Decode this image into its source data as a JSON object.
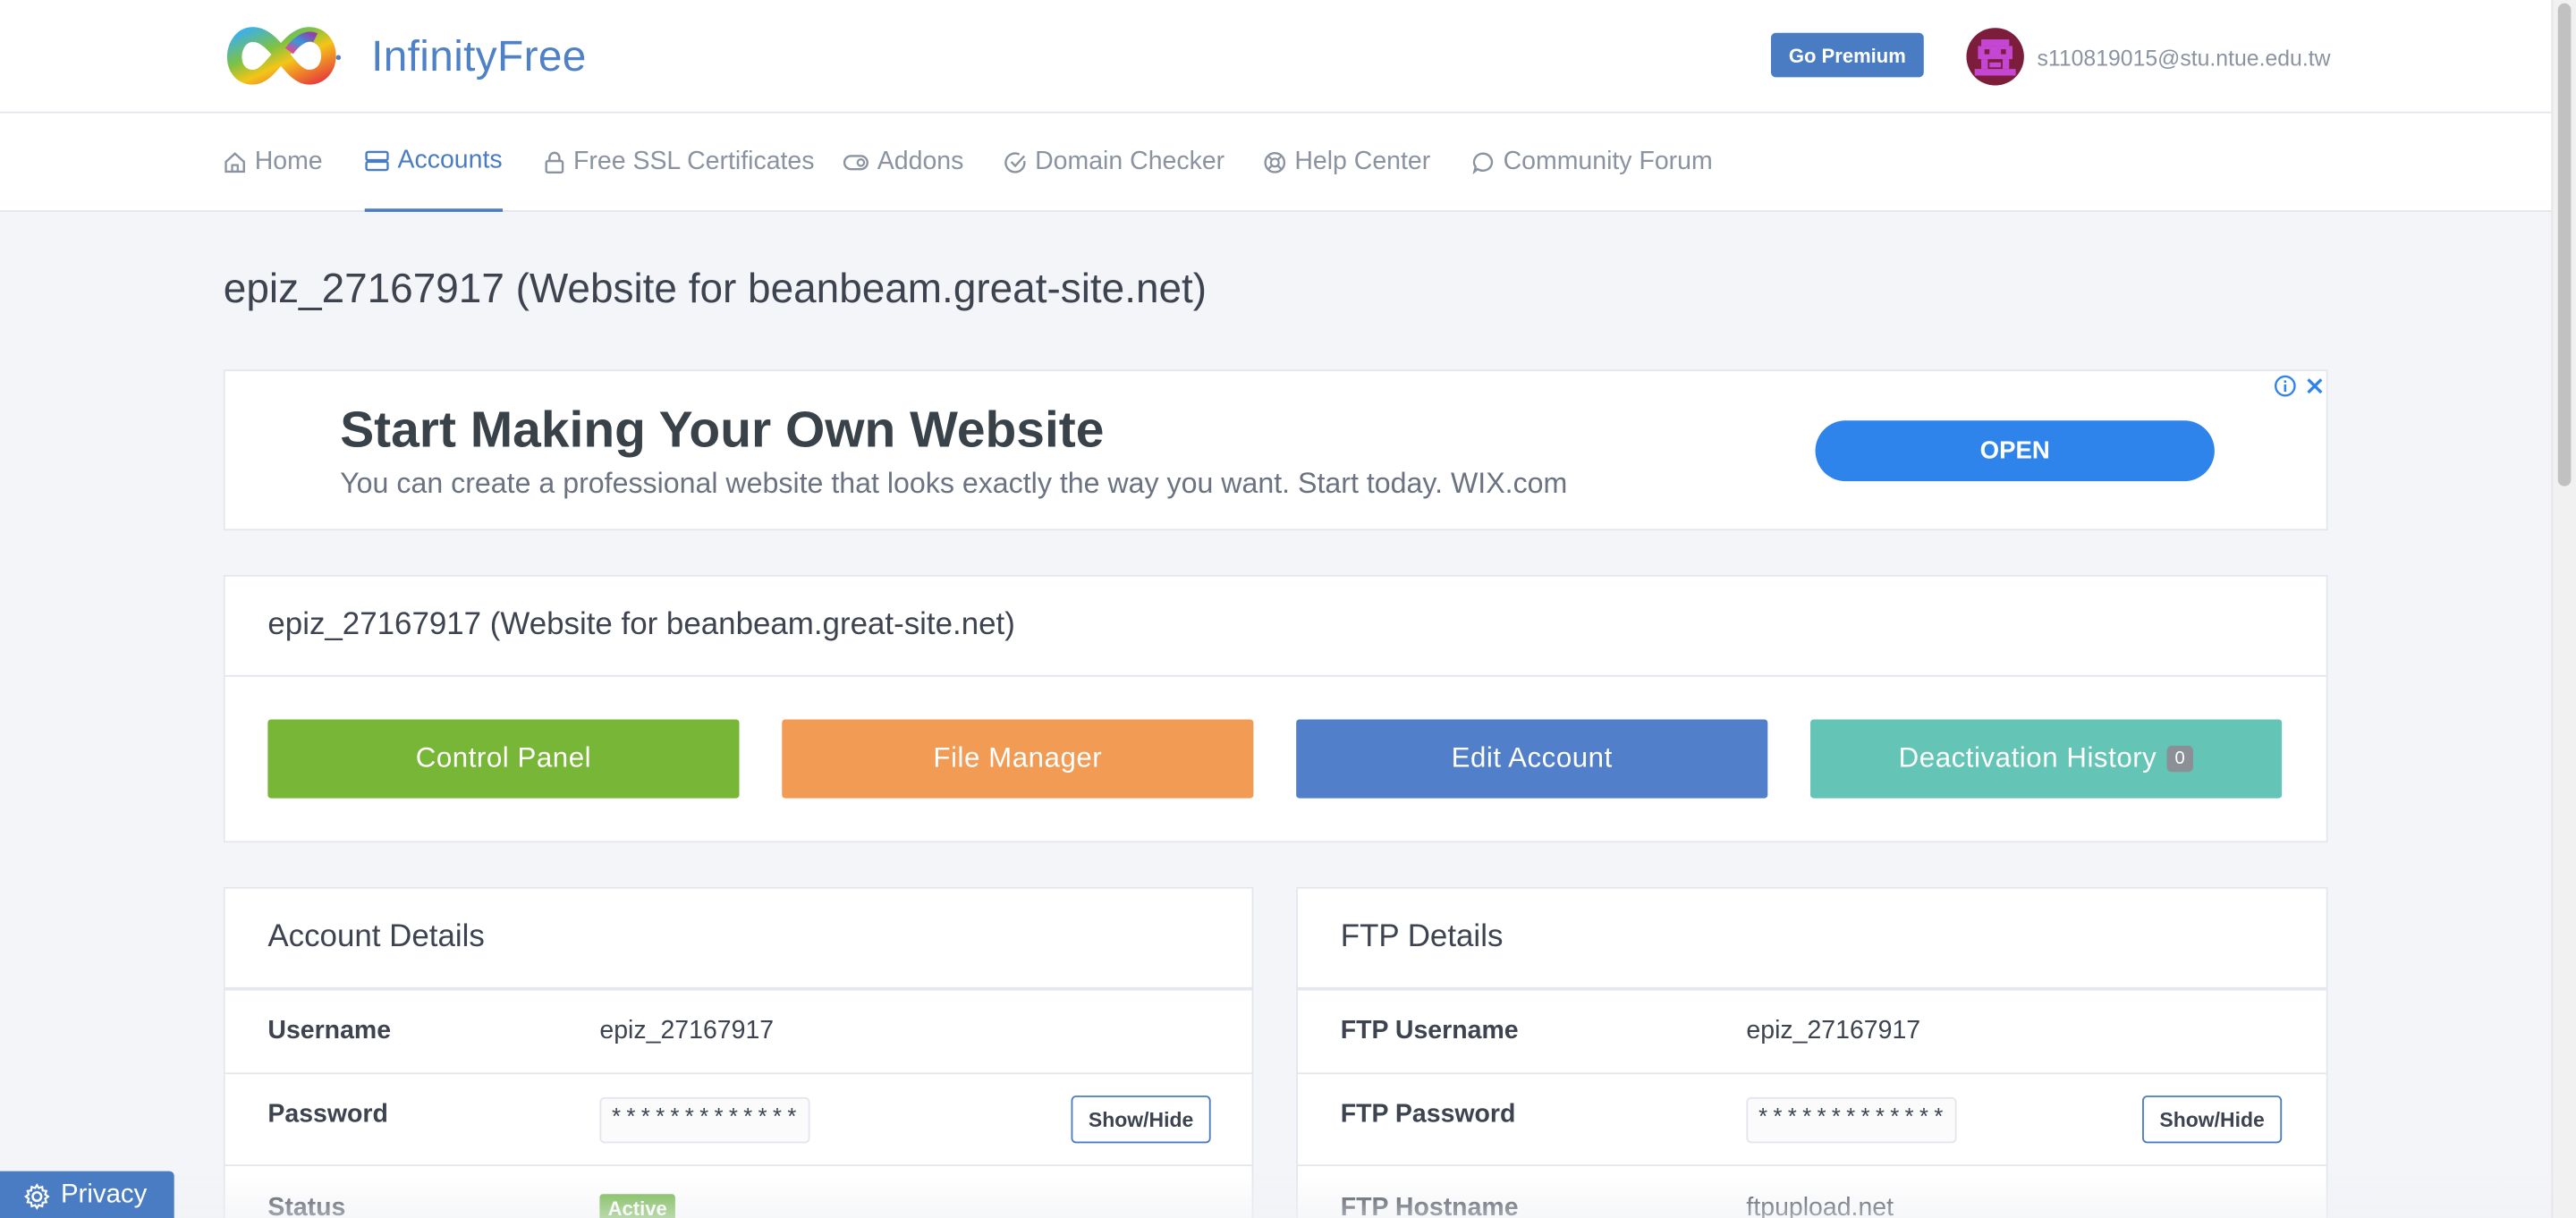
{
  "header": {
    "brand": "InfinityFree",
    "premium_label": "Go Premium",
    "user_email": "s110819015@stu.ntue.edu.tw"
  },
  "nav": {
    "items": [
      {
        "label": "Home",
        "icon": "home-icon"
      },
      {
        "label": "Accounts",
        "icon": "accounts-icon",
        "active": true
      },
      {
        "label": "Free SSL Certificates",
        "icon": "lock-icon"
      },
      {
        "label": "Addons",
        "icon": "toggle-icon"
      },
      {
        "label": "Domain Checker",
        "icon": "check-circle-icon"
      },
      {
        "label": "Help Center",
        "icon": "lifebuoy-icon"
      },
      {
        "label": "Community Forum",
        "icon": "chat-icon"
      }
    ]
  },
  "page": {
    "title": "epiz_27167917 (Website for beanbeam.great-site.net)"
  },
  "ad": {
    "title": "Start Making Your Own Website",
    "body": "You can create a professional website that looks exactly the way you want. Start today. WIX.com",
    "cta": "OPEN"
  },
  "account_card": {
    "title": "epiz_27167917 (Website for beanbeam.great-site.net)",
    "buttons": {
      "control_panel": "Control Panel",
      "file_manager": "File Manager",
      "edit_account": "Edit Account",
      "deactivation_history": "Deactivation History",
      "deactivation_count": "0"
    }
  },
  "account_details": {
    "title": "Account Details",
    "username_label": "Username",
    "username_value": "epiz_27167917",
    "password_label": "Password",
    "password_value": "*************",
    "show_hide": "Show/Hide",
    "status_label": "Status",
    "status_value": "Active"
  },
  "ftp_details": {
    "title": "FTP Details",
    "username_label": "FTP Username",
    "username_value": "epiz_27167917",
    "password_label": "FTP Password",
    "password_value": "*************",
    "show_hide": "Show/Hide",
    "hostname_label": "FTP Hostname",
    "hostname_value": "ftpupload.net"
  },
  "footer": {
    "privacy": "Privacy"
  },
  "colors": {
    "brand_blue": "#4a7cc3",
    "control_panel": "#77b637",
    "file_manager": "#f29b55",
    "edit_account": "#527fc9",
    "deactivation_history": "#64c4b6",
    "status_active": "#6ab43f",
    "ad_button": "#2f84ec"
  }
}
